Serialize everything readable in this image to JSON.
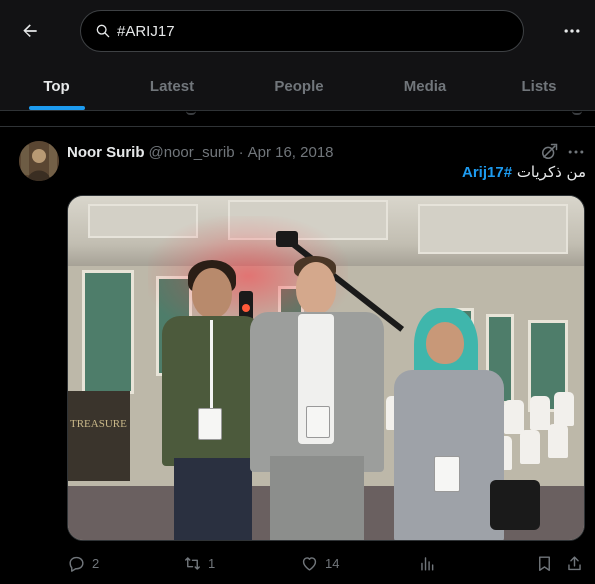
{
  "search": {
    "query": "#ARIJ17"
  },
  "tabs": [
    {
      "label": "Top",
      "active": true
    },
    {
      "label": "Latest",
      "active": false
    },
    {
      "label": "People",
      "active": false
    },
    {
      "label": "Media",
      "active": false
    },
    {
      "label": "Lists",
      "active": false
    }
  ],
  "tweet": {
    "author_name": "Noor Surib",
    "author_handle": "@noor_surib",
    "separator": "·",
    "date": "Apr 16, 2018",
    "text_arabic": "من ذكريات",
    "hashtag": "#Arij17",
    "photo_sign_text": "TREASURE",
    "actions": {
      "reply_count": "2",
      "retweet_count": "1",
      "like_count": "14"
    }
  },
  "icons": {
    "back": "arrow-left-icon",
    "search": "search-icon",
    "more": "more-horizontal-icon",
    "grok": "grok-icon",
    "reply": "reply-icon",
    "retweet": "retweet-icon",
    "like": "heart-icon",
    "views": "views-chart-icon",
    "bookmark": "bookmark-icon",
    "share": "share-icon"
  },
  "colors": {
    "accent": "#1d9bf0",
    "background": "#000000",
    "muted": "#71767b",
    "text": "#e7e9ea"
  }
}
